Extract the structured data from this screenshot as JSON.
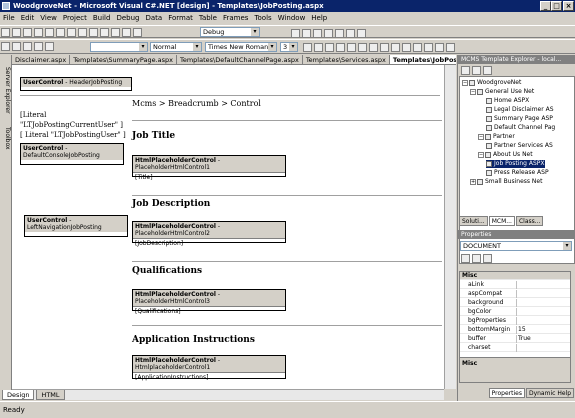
{
  "window": {
    "title": "WoodgroveNet - Microsoft Visual C#.NET [design] - Templates\\JobPosting.aspx"
  },
  "menu": [
    "File",
    "Edit",
    "View",
    "Project",
    "Build",
    "Debug",
    "Data",
    "Format",
    "Table",
    "Frames",
    "Tools",
    "Window",
    "Help"
  ],
  "toolbar": {
    "config": "Debug",
    "block_format": "Normal",
    "font_name": "Times New Roman",
    "font_size": "3"
  },
  "sidebar": {
    "server_explorer": "Server Explorer",
    "toolbox": "Toolbox"
  },
  "doc_tabs": [
    "Disclaimer.aspx",
    "Templates\\SummaryPage.aspx",
    "Templates\\DefaultChannelPage.aspx",
    "Templates\\Services.aspx",
    "Templates\\JobPosting.aspx"
  ],
  "design": {
    "header_ctl": {
      "kind": "UserControl",
      "name": "HeaderJobPosting"
    },
    "literal1": "[Literal",
    "literal2": "\"LTJobPostingCurrentUser\" ]",
    "literal3": "[ Literal \"LTJobPostingUser\" ]",
    "console_ctl": {
      "kind": "UserControl",
      "name": "DefaultConsoleJobPosting"
    },
    "left_nav_ctl": {
      "kind": "UserControl",
      "name": "LeftNavigationJobPosting"
    },
    "breadcrumb": "Mcms > Breadcrumb > Control",
    "sections": [
      {
        "heading": "Job Title",
        "ctl_kind": "HtmlPlaceholderControl",
        "ctl_name": "PlaceholderHtmlControl1",
        "body": "[Title]"
      },
      {
        "heading": "Job Description",
        "ctl_kind": "HtmlPlaceholderControl",
        "ctl_name": "PlaceholderHtmlControl2",
        "body": "[JobDescription]"
      },
      {
        "heading": "Qualifications",
        "ctl_kind": "HtmlPlaceholderControl",
        "ctl_name": "PlaceholderHtmlControl3",
        "body": "[Qualifications]"
      },
      {
        "heading": "Application Instructions",
        "ctl_kind": "HtmlPlaceholderControl",
        "ctl_name": "HtmlplaceholderControl1",
        "body": "[ApplicationInstructions]"
      }
    ],
    "ctl_sep": " - "
  },
  "view_tabs": [
    "Design",
    "HTML"
  ],
  "status": "Ready",
  "explorer": {
    "title": "MCMS Template Explorer - local...",
    "tree": [
      {
        "label": "WoodgroveNet",
        "expander": "−"
      },
      {
        "label": "General Use Net",
        "expander": "−"
      },
      {
        "label": "Home ASPX"
      },
      {
        "label": "Legal Disclaimer AS"
      },
      {
        "label": "Summary Page ASP"
      },
      {
        "label": "Default Channel Pag"
      },
      {
        "label": "Partner",
        "expander": "−"
      },
      {
        "label": "Partner Services AS"
      },
      {
        "label": "About Us Net",
        "expander": "−"
      },
      {
        "label": "Job Posting ASPX",
        "selected": true
      },
      {
        "label": "Press Release ASP"
      },
      {
        "label": "Small Business Net",
        "expander": "+"
      }
    ],
    "tabs": [
      "Soluti...",
      "MCM...",
      "Class..."
    ]
  },
  "properties": {
    "title": "Properties",
    "object": "DOCUMENT",
    "category": "Misc",
    "rows": [
      {
        "name": "aLink",
        "value": ""
      },
      {
        "name": "aspCompat",
        "value": ""
      },
      {
        "name": "background",
        "value": ""
      },
      {
        "name": "bgColor",
        "value": ""
      },
      {
        "name": "bgProperties",
        "value": ""
      },
      {
        "name": "bottomMargin",
        "value": "15"
      },
      {
        "name": "buffer",
        "value": "True"
      },
      {
        "name": "charset",
        "value": ""
      }
    ],
    "desc_title": "Misc",
    "bottom_tabs": [
      "Properties",
      "Dynamic Help"
    ]
  }
}
